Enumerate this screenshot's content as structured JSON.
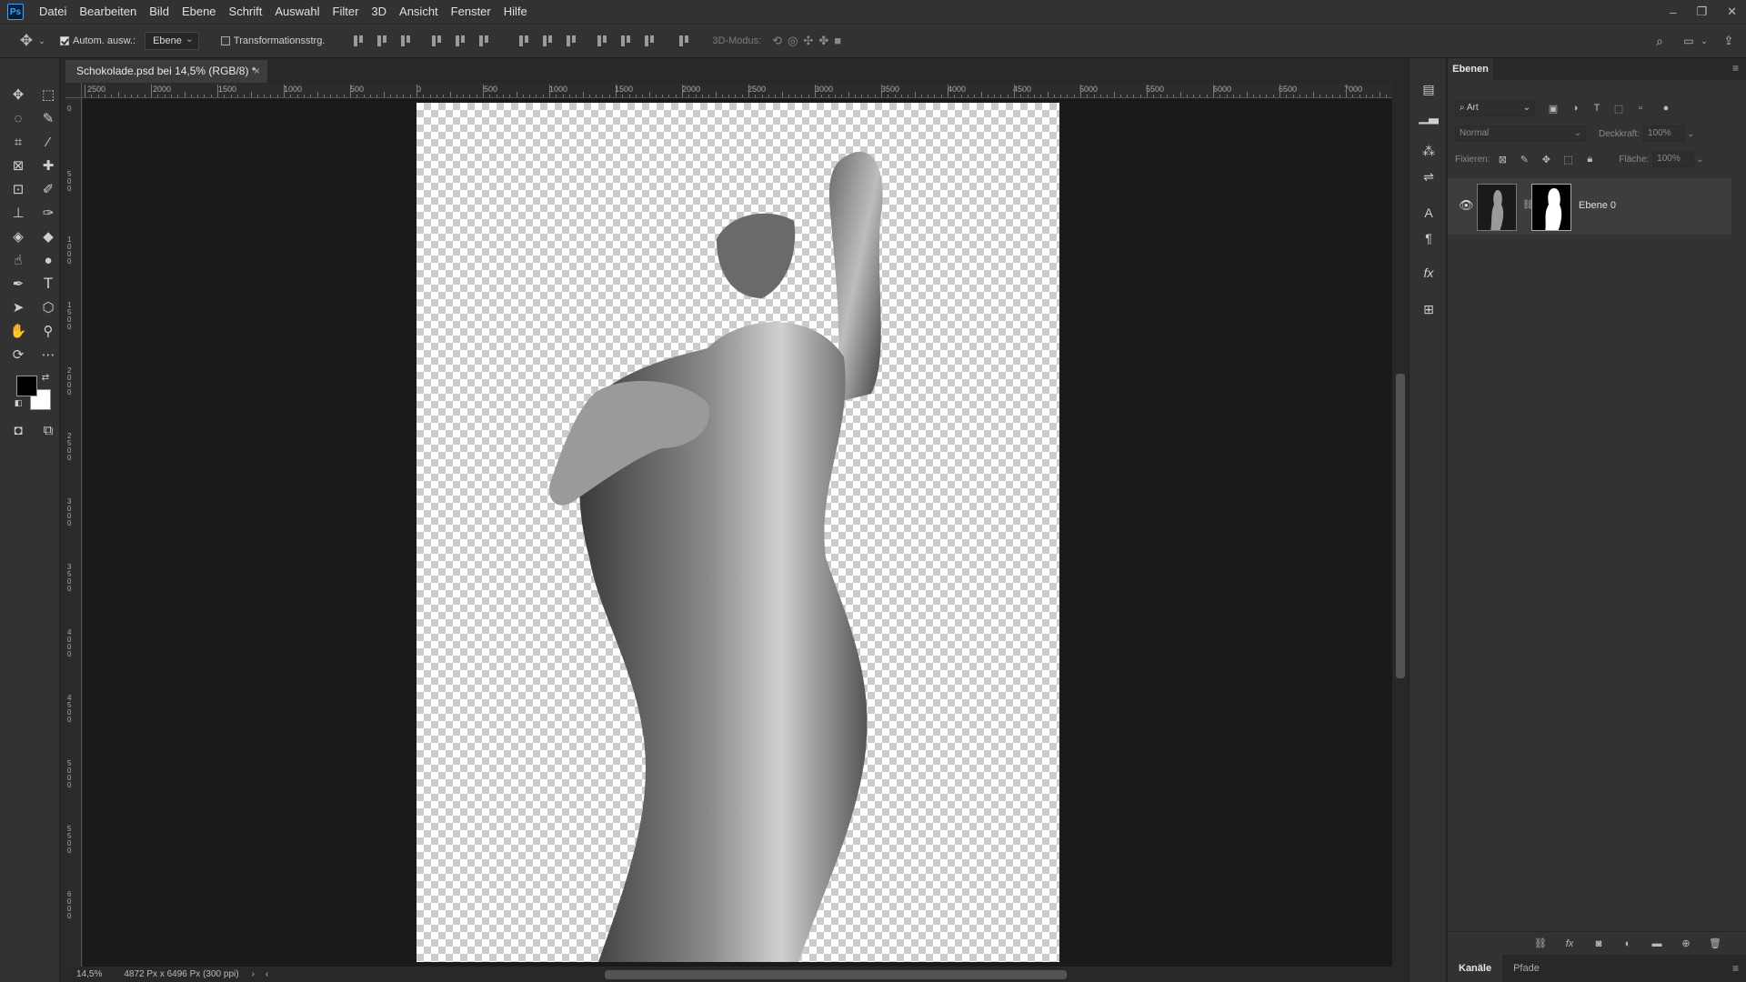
{
  "app": {
    "logo": "Ps"
  },
  "menu": [
    "Datei",
    "Bearbeiten",
    "Bild",
    "Ebene",
    "Schrift",
    "Auswahl",
    "Filter",
    "3D",
    "Ansicht",
    "Fenster",
    "Hilfe"
  ],
  "options": {
    "auto_select_label": "Autom. ausw.:",
    "auto_select_value": "Ebene",
    "transform_label": "Transformationsstrg.",
    "mode_3d_label": "3D-Modus:"
  },
  "document": {
    "tab_title": "Schokolade.psd bei 14,5% (RGB/8) *",
    "close": "×",
    "zoom": "14,5%",
    "size_info": "4872 Px x 6496 Px (300 ppi)"
  },
  "ruler_top": [
    "2500",
    "2000",
    "1500",
    "1000",
    "500",
    "0",
    "500",
    "1000",
    "1500",
    "2000",
    "2500",
    "3000",
    "3500",
    "4000",
    "4500",
    "5000",
    "5500",
    "6000",
    "6500",
    "7000"
  ],
  "ruler_left": [
    "0",
    "5 0 0",
    "1 0 0 0",
    "1 5 0 0",
    "2 0 0 0",
    "2 5 0 0",
    "3 0 0 0",
    "3 5 0 0",
    "4 0 0 0",
    "4 5 0 0",
    "5 0 0 0",
    "5 5 0 0",
    "6 0 0 0"
  ],
  "panel": {
    "tab": "Ebenen",
    "filter_kind": "Art",
    "blend_mode": "Normal",
    "opacity_label": "Deckkraft:",
    "opacity_value": "100%",
    "lock_label": "Fixieren:",
    "fill_label": "Fläche:",
    "fill_value": "100%",
    "layers": [
      {
        "name": "Ebene 0",
        "visible": true
      }
    ],
    "bottom_tabs": [
      "Kanäle",
      "Pfade"
    ]
  },
  "colors": {
    "accent": "#31a8ff",
    "foreground": "#000000",
    "background": "#ffffff"
  }
}
